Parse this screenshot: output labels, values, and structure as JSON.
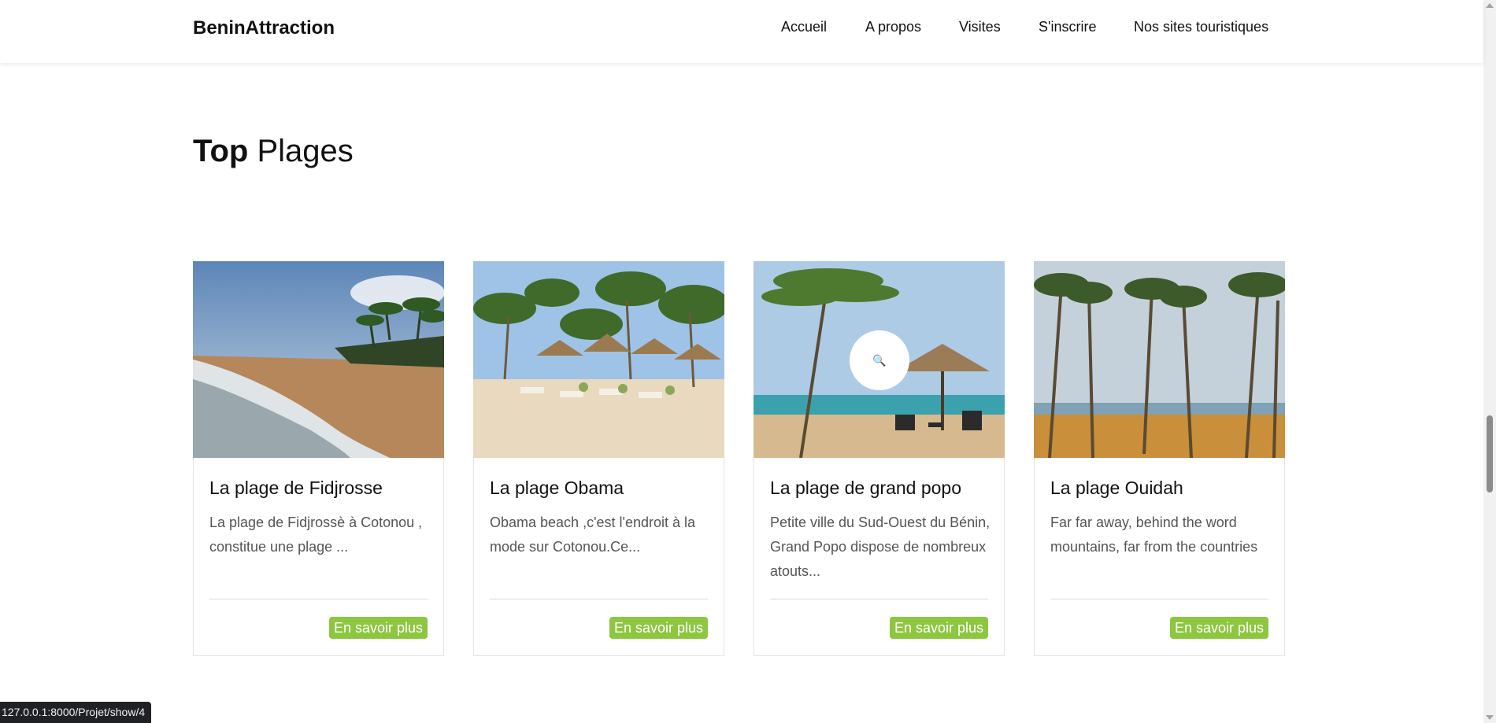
{
  "nav": {
    "brand": "BeninAttraction",
    "links": [
      "Accueil",
      "A propos",
      "Visites",
      "S'inscrire",
      "Nos sites touristiques"
    ]
  },
  "section": {
    "title_bold": "Top",
    "title_rest": "Plages"
  },
  "cards": [
    {
      "title": "La plage de Fidjrosse",
      "description": "La plage de Fidjrossè à Cotonou , constitue une plage ...",
      "button": "En savoir plus"
    },
    {
      "title": "La plage Obama",
      "description": "Obama beach ,c'est l'endroit à la mode sur Cotonou.Ce...",
      "button": "En savoir plus"
    },
    {
      "title": "La plage de grand popo",
      "description": "Petite ville du Sud-Ouest du Bénin, Grand Popo dispose de nombreux atouts...",
      "button": "En savoir plus",
      "overlay_icon": "search-icon"
    },
    {
      "title": "La plage Ouidah",
      "description": "Far far away, behind the word mountains, far from the countries",
      "button": "En savoir plus"
    }
  ],
  "status_bar": {
    "url": "127.0.0.1:8000/Projet/show/4"
  },
  "colors": {
    "button_bg": "#8dc63f",
    "text": "#111111",
    "muted": "#555555"
  }
}
